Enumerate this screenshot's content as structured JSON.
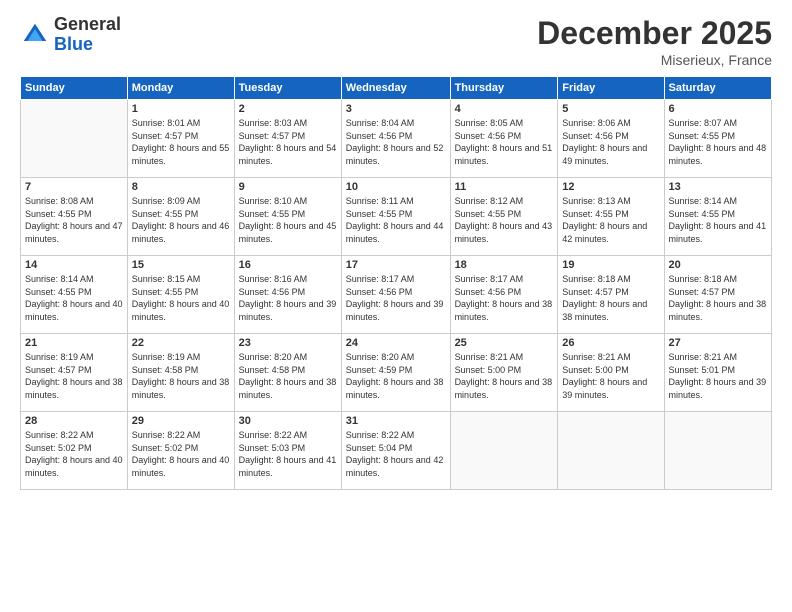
{
  "header": {
    "logo_line1": "General",
    "logo_line2": "Blue",
    "month_title": "December 2025",
    "location": "Miserieux, France"
  },
  "days_of_week": [
    "Sunday",
    "Monday",
    "Tuesday",
    "Wednesday",
    "Thursday",
    "Friday",
    "Saturday"
  ],
  "weeks": [
    [
      {
        "day": "",
        "sunrise": "",
        "sunset": "",
        "daylight": ""
      },
      {
        "day": "1",
        "sunrise": "8:01 AM",
        "sunset": "4:57 PM",
        "daylight": "8 hours and 55 minutes."
      },
      {
        "day": "2",
        "sunrise": "8:03 AM",
        "sunset": "4:57 PM",
        "daylight": "8 hours and 54 minutes."
      },
      {
        "day": "3",
        "sunrise": "8:04 AM",
        "sunset": "4:56 PM",
        "daylight": "8 hours and 52 minutes."
      },
      {
        "day": "4",
        "sunrise": "8:05 AM",
        "sunset": "4:56 PM",
        "daylight": "8 hours and 51 minutes."
      },
      {
        "day": "5",
        "sunrise": "8:06 AM",
        "sunset": "4:56 PM",
        "daylight": "8 hours and 49 minutes."
      },
      {
        "day": "6",
        "sunrise": "8:07 AM",
        "sunset": "4:55 PM",
        "daylight": "8 hours and 48 minutes."
      }
    ],
    [
      {
        "day": "7",
        "sunrise": "8:08 AM",
        "sunset": "4:55 PM",
        "daylight": "8 hours and 47 minutes."
      },
      {
        "day": "8",
        "sunrise": "8:09 AM",
        "sunset": "4:55 PM",
        "daylight": "8 hours and 46 minutes."
      },
      {
        "day": "9",
        "sunrise": "8:10 AM",
        "sunset": "4:55 PM",
        "daylight": "8 hours and 45 minutes."
      },
      {
        "day": "10",
        "sunrise": "8:11 AM",
        "sunset": "4:55 PM",
        "daylight": "8 hours and 44 minutes."
      },
      {
        "day": "11",
        "sunrise": "8:12 AM",
        "sunset": "4:55 PM",
        "daylight": "8 hours and 43 minutes."
      },
      {
        "day": "12",
        "sunrise": "8:13 AM",
        "sunset": "4:55 PM",
        "daylight": "8 hours and 42 minutes."
      },
      {
        "day": "13",
        "sunrise": "8:14 AM",
        "sunset": "4:55 PM",
        "daylight": "8 hours and 41 minutes."
      }
    ],
    [
      {
        "day": "14",
        "sunrise": "8:14 AM",
        "sunset": "4:55 PM",
        "daylight": "8 hours and 40 minutes."
      },
      {
        "day": "15",
        "sunrise": "8:15 AM",
        "sunset": "4:55 PM",
        "daylight": "8 hours and 40 minutes."
      },
      {
        "day": "16",
        "sunrise": "8:16 AM",
        "sunset": "4:56 PM",
        "daylight": "8 hours and 39 minutes."
      },
      {
        "day": "17",
        "sunrise": "8:17 AM",
        "sunset": "4:56 PM",
        "daylight": "8 hours and 39 minutes."
      },
      {
        "day": "18",
        "sunrise": "8:17 AM",
        "sunset": "4:56 PM",
        "daylight": "8 hours and 38 minutes."
      },
      {
        "day": "19",
        "sunrise": "8:18 AM",
        "sunset": "4:57 PM",
        "daylight": "8 hours and 38 minutes."
      },
      {
        "day": "20",
        "sunrise": "8:18 AM",
        "sunset": "4:57 PM",
        "daylight": "8 hours and 38 minutes."
      }
    ],
    [
      {
        "day": "21",
        "sunrise": "8:19 AM",
        "sunset": "4:57 PM",
        "daylight": "8 hours and 38 minutes."
      },
      {
        "day": "22",
        "sunrise": "8:19 AM",
        "sunset": "4:58 PM",
        "daylight": "8 hours and 38 minutes."
      },
      {
        "day": "23",
        "sunrise": "8:20 AM",
        "sunset": "4:58 PM",
        "daylight": "8 hours and 38 minutes."
      },
      {
        "day": "24",
        "sunrise": "8:20 AM",
        "sunset": "4:59 PM",
        "daylight": "8 hours and 38 minutes."
      },
      {
        "day": "25",
        "sunrise": "8:21 AM",
        "sunset": "5:00 PM",
        "daylight": "8 hours and 38 minutes."
      },
      {
        "day": "26",
        "sunrise": "8:21 AM",
        "sunset": "5:00 PM",
        "daylight": "8 hours and 39 minutes."
      },
      {
        "day": "27",
        "sunrise": "8:21 AM",
        "sunset": "5:01 PM",
        "daylight": "8 hours and 39 minutes."
      }
    ],
    [
      {
        "day": "28",
        "sunrise": "8:22 AM",
        "sunset": "5:02 PM",
        "daylight": "8 hours and 40 minutes."
      },
      {
        "day": "29",
        "sunrise": "8:22 AM",
        "sunset": "5:02 PM",
        "daylight": "8 hours and 40 minutes."
      },
      {
        "day": "30",
        "sunrise": "8:22 AM",
        "sunset": "5:03 PM",
        "daylight": "8 hours and 41 minutes."
      },
      {
        "day": "31",
        "sunrise": "8:22 AM",
        "sunset": "5:04 PM",
        "daylight": "8 hours and 42 minutes."
      },
      {
        "day": "",
        "sunrise": "",
        "sunset": "",
        "daylight": ""
      },
      {
        "day": "",
        "sunrise": "",
        "sunset": "",
        "daylight": ""
      },
      {
        "day": "",
        "sunrise": "",
        "sunset": "",
        "daylight": ""
      }
    ]
  ]
}
